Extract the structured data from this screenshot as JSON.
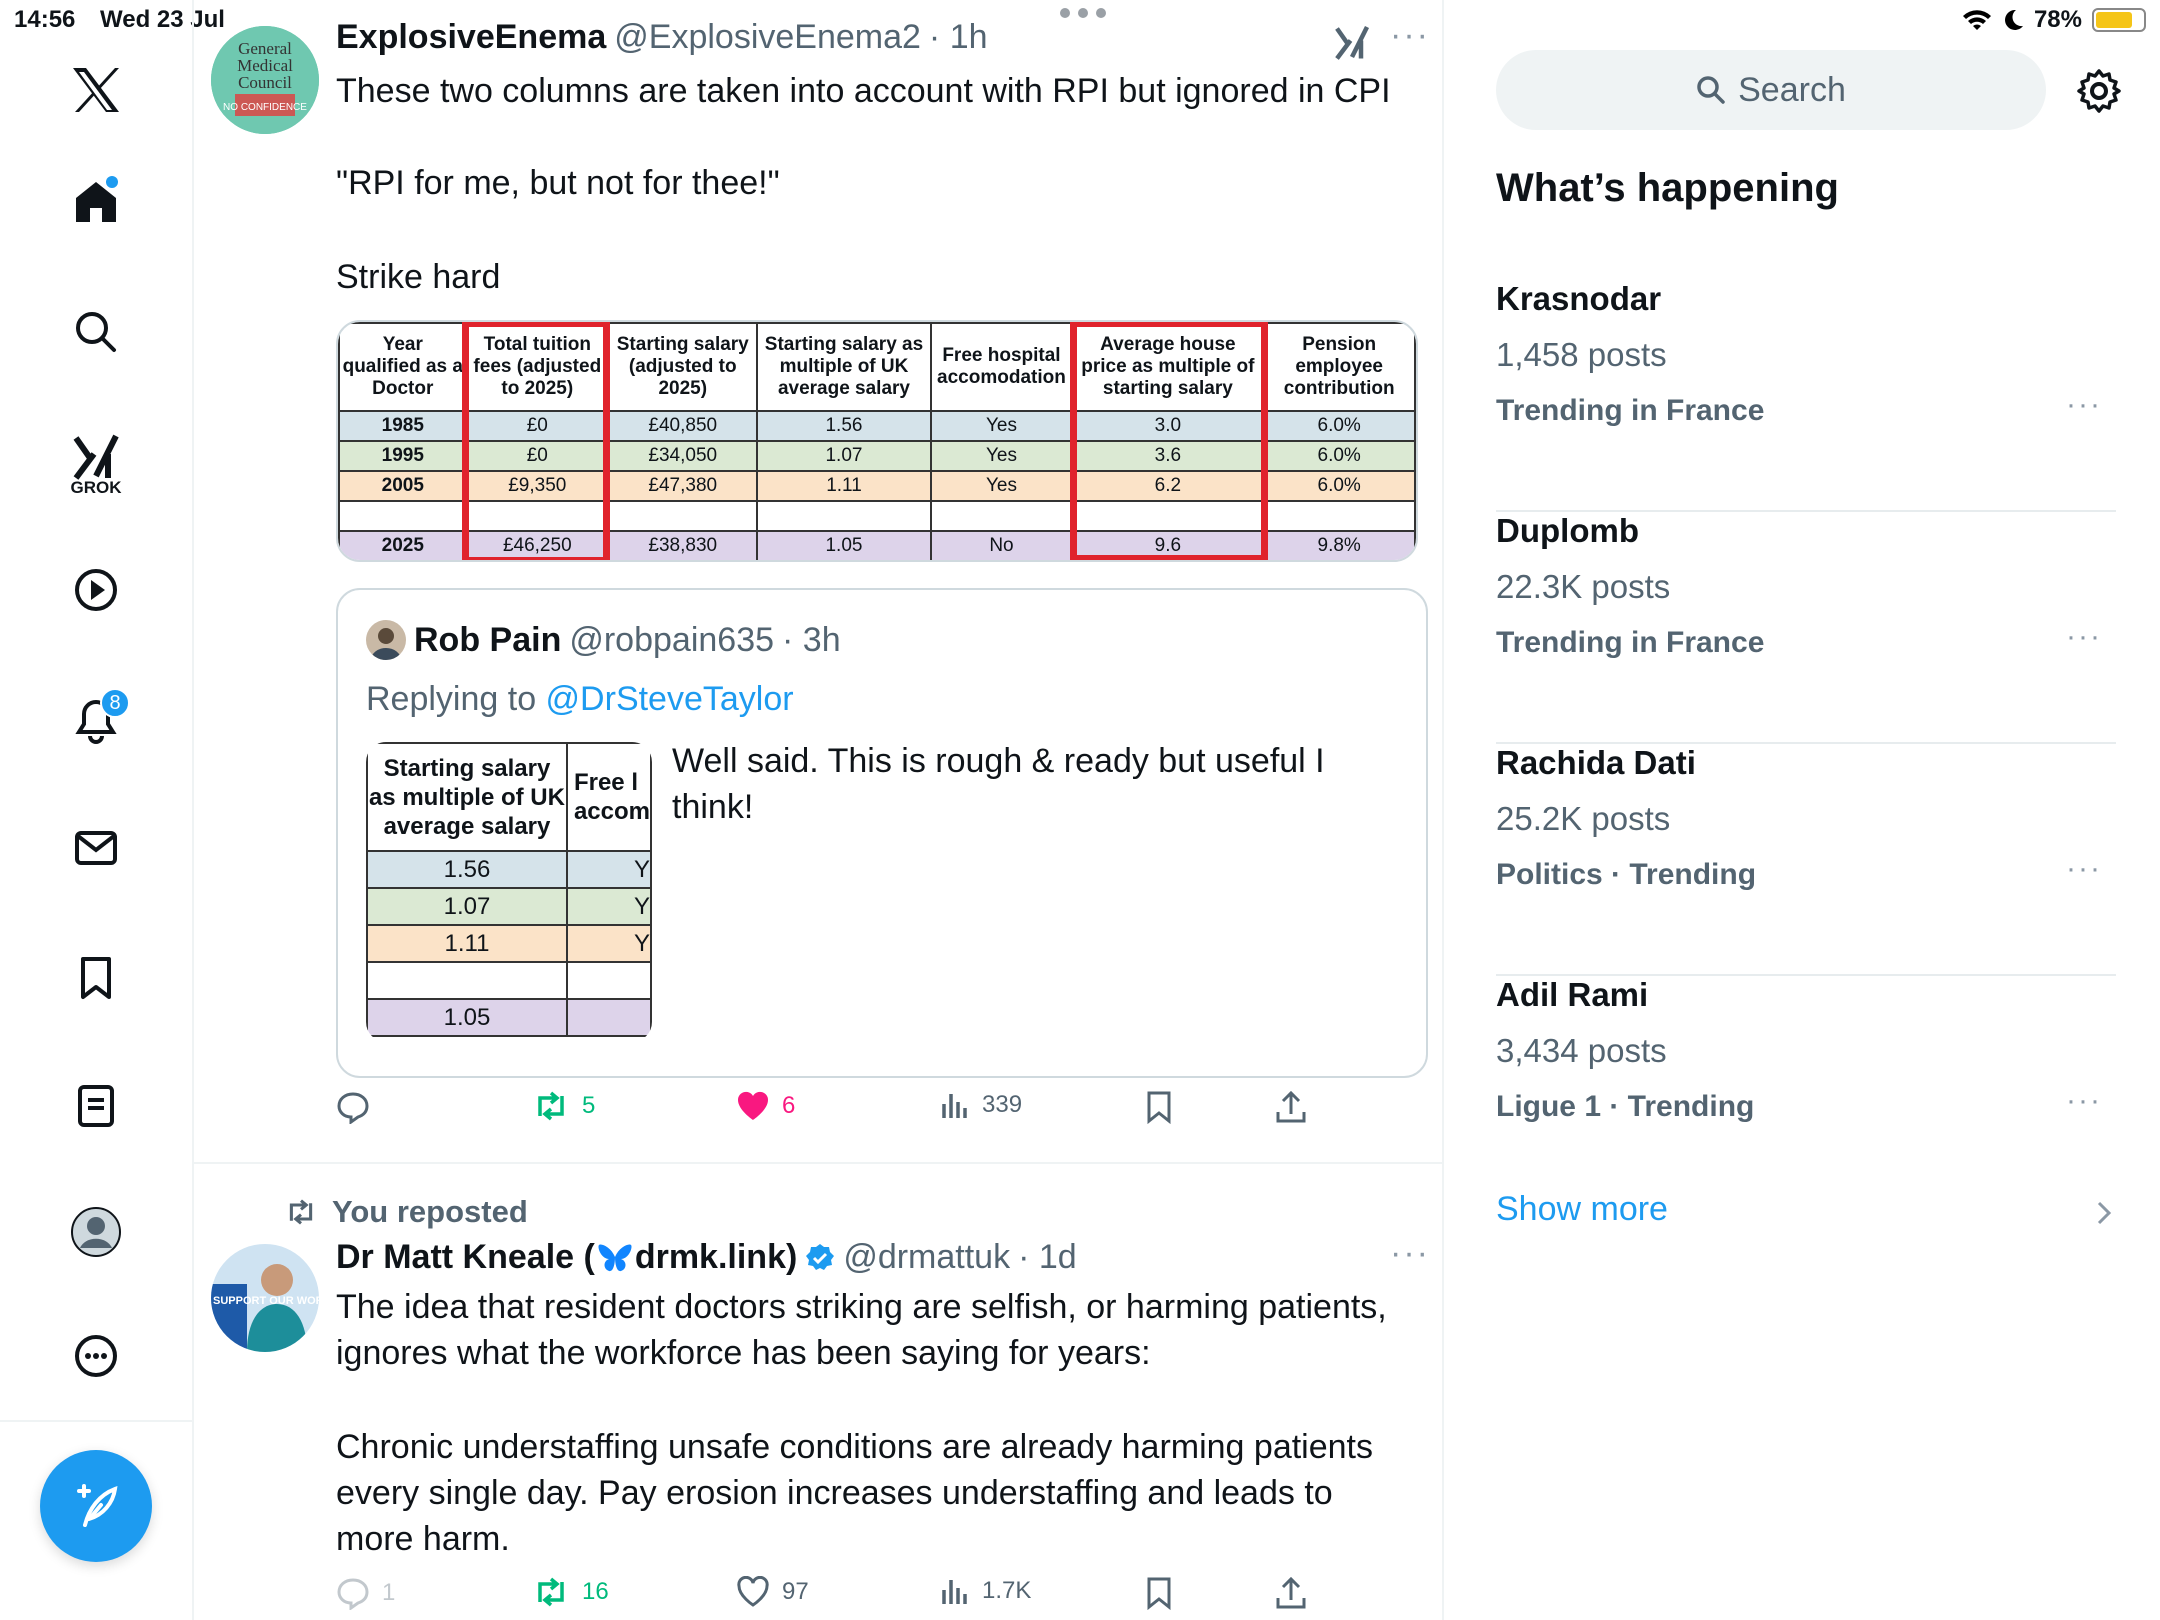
{
  "status_bar": {
    "time": "14:56",
    "date": "Wed 23 Jul",
    "battery": "78%"
  },
  "nav": {
    "grok_label": "GROK",
    "notifications_badge": "8"
  },
  "tweets": [
    {
      "name": "ExplosiveEnema",
      "handle": "@ExplosiveEnema2",
      "time": "· 1h",
      "avatar_text": [
        "General",
        "Medical",
        "Council",
        "NO CONFIDENCE"
      ],
      "text_lines": [
        "These two columns are taken into account with RPI but ignored in CPI",
        "\"RPI for me, but not for thee!\"",
        "Strike hard"
      ],
      "table": {
        "headers": [
          "Year qualified as a Doctor",
          "Total tuition fees (adjusted to 2025)",
          "Starting salary (adjusted to 2025)",
          "Starting salary as multiple of UK average salary",
          "Free hospital accomodation",
          "Average house price as multiple of starting salary",
          "Pension employee contribution"
        ],
        "rows": [
          [
            "1985",
            "£0",
            "£40,850",
            "1.56",
            "Yes",
            "3.0",
            "6.0%"
          ],
          [
            "1995",
            "£0",
            "£34,050",
            "1.07",
            "Yes",
            "3.6",
            "6.0%"
          ],
          [
            "2005",
            "£9,350",
            "£47,380",
            "1.11",
            "Yes",
            "6.2",
            "6.0%"
          ],
          [
            "",
            "",
            "",
            "",
            "",
            "",
            ""
          ],
          [
            "2025",
            "£46,250",
            "£38,830",
            "1.05",
            "No",
            "9.6",
            "9.8%"
          ]
        ]
      },
      "quote": {
        "name": "Rob Pain",
        "handle": "@robpain635",
        "time": "· 3h",
        "replying_prefix": "Replying to ",
        "replying_to": "@DrSteveTaylor",
        "text": "Well said. This is rough & ready but useful I think!",
        "image_table": {
          "headers": [
            "Starting salary as multiple of UK average salary",
            "Free hospital accomodation"
          ],
          "header_visible": [
            "Starting salary as multiple of UK average salary",
            "Free l accom"
          ],
          "rows": [
            [
              "1.56",
              "Y"
            ],
            [
              "1.07",
              "Y"
            ],
            [
              "1.11",
              "Y"
            ],
            [
              "",
              ""
            ],
            [
              "1.05",
              ""
            ]
          ]
        }
      },
      "actions": {
        "replies": "",
        "reposts": "5",
        "likes": "6",
        "views": "339"
      }
    },
    {
      "repost_label": "You reposted",
      "name": "Dr Matt Kneale (",
      "name_suffix": "drmk.link)",
      "handle": "@drmattuk",
      "time": "· 1d",
      "avatar_text": "SUPPORT OUR WORK",
      "text_lines": [
        "The idea that resident doctors striking are selfish, or harming patients, ignores what the workforce has been saying for years:",
        "Chronic understaffing unsafe conditions are already harming patients every single day. Pay erosion increases understaffing and leads to more harm."
      ],
      "actions": {
        "replies": "1",
        "reposts": "16",
        "likes": "97",
        "views": "1.7K"
      }
    }
  ],
  "sidebar": {
    "search_placeholder": "Search",
    "title": "What’s happening",
    "trends": [
      {
        "name": "Krasnodar",
        "posts": "1,458 posts",
        "context": "Trending in France"
      },
      {
        "name": "Duplomb",
        "posts": "22.3K posts",
        "context": "Trending in France"
      },
      {
        "name": "Rachida Dati",
        "posts": "25.2K posts",
        "context": "Politics · Trending"
      },
      {
        "name": "Adil Rami",
        "posts": "3,434 posts",
        "context": "Ligue 1 · Trending"
      }
    ],
    "show_more": "Show more"
  },
  "colors": {
    "accent": "#1d9bf0",
    "repost_green": "#00ba7c",
    "like_pink": "#f91880",
    "highlight_red": "#e0232c"
  }
}
